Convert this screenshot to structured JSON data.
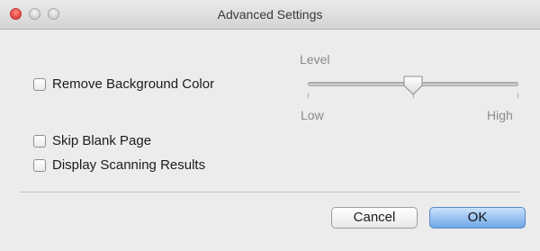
{
  "window": {
    "title": "Advanced Settings"
  },
  "options": {
    "remove_background_color": {
      "label": "Remove Background Color",
      "checked": false
    },
    "skip_blank_page": {
      "label": "Skip Blank Page",
      "checked": false
    },
    "display_scanning_results": {
      "label": "Display Scanning Results",
      "checked": false
    }
  },
  "level_slider": {
    "label": "Level",
    "min_label": "Low",
    "max_label": "High",
    "value": 0.5,
    "ticks": 3
  },
  "buttons": {
    "cancel": "Cancel",
    "ok": "OK"
  },
  "colors": {
    "default_button": "#6fa7ea",
    "close_button": "#e0443e"
  }
}
